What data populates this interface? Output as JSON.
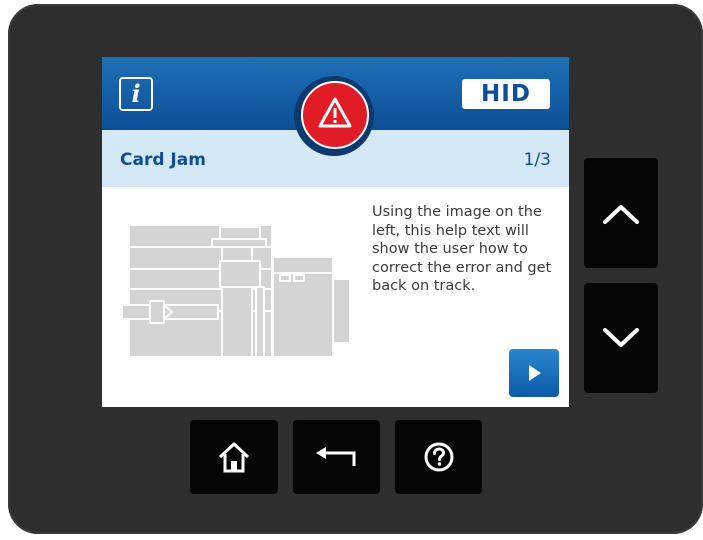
{
  "header": {
    "info_icon_glyph": "i",
    "brand_label": "HID",
    "alert_icon": "warning-triangle-icon",
    "accent_color": "#0d4f96",
    "alert_color": "#e21c26"
  },
  "title_bar": {
    "title": "Card Jam",
    "pager": "1/3"
  },
  "content": {
    "illustration_icon": "printer-diagram-icon",
    "help_text": "Using the image on the left, this help text will show the user how to correct the error and get back on track.",
    "next_icon": "play-arrow-icon"
  },
  "hardware_buttons": {
    "side": [
      "chevron-up-icon",
      "chevron-down-icon"
    ],
    "bottom": [
      "home-icon",
      "back-arrow-icon",
      "help-icon"
    ]
  }
}
